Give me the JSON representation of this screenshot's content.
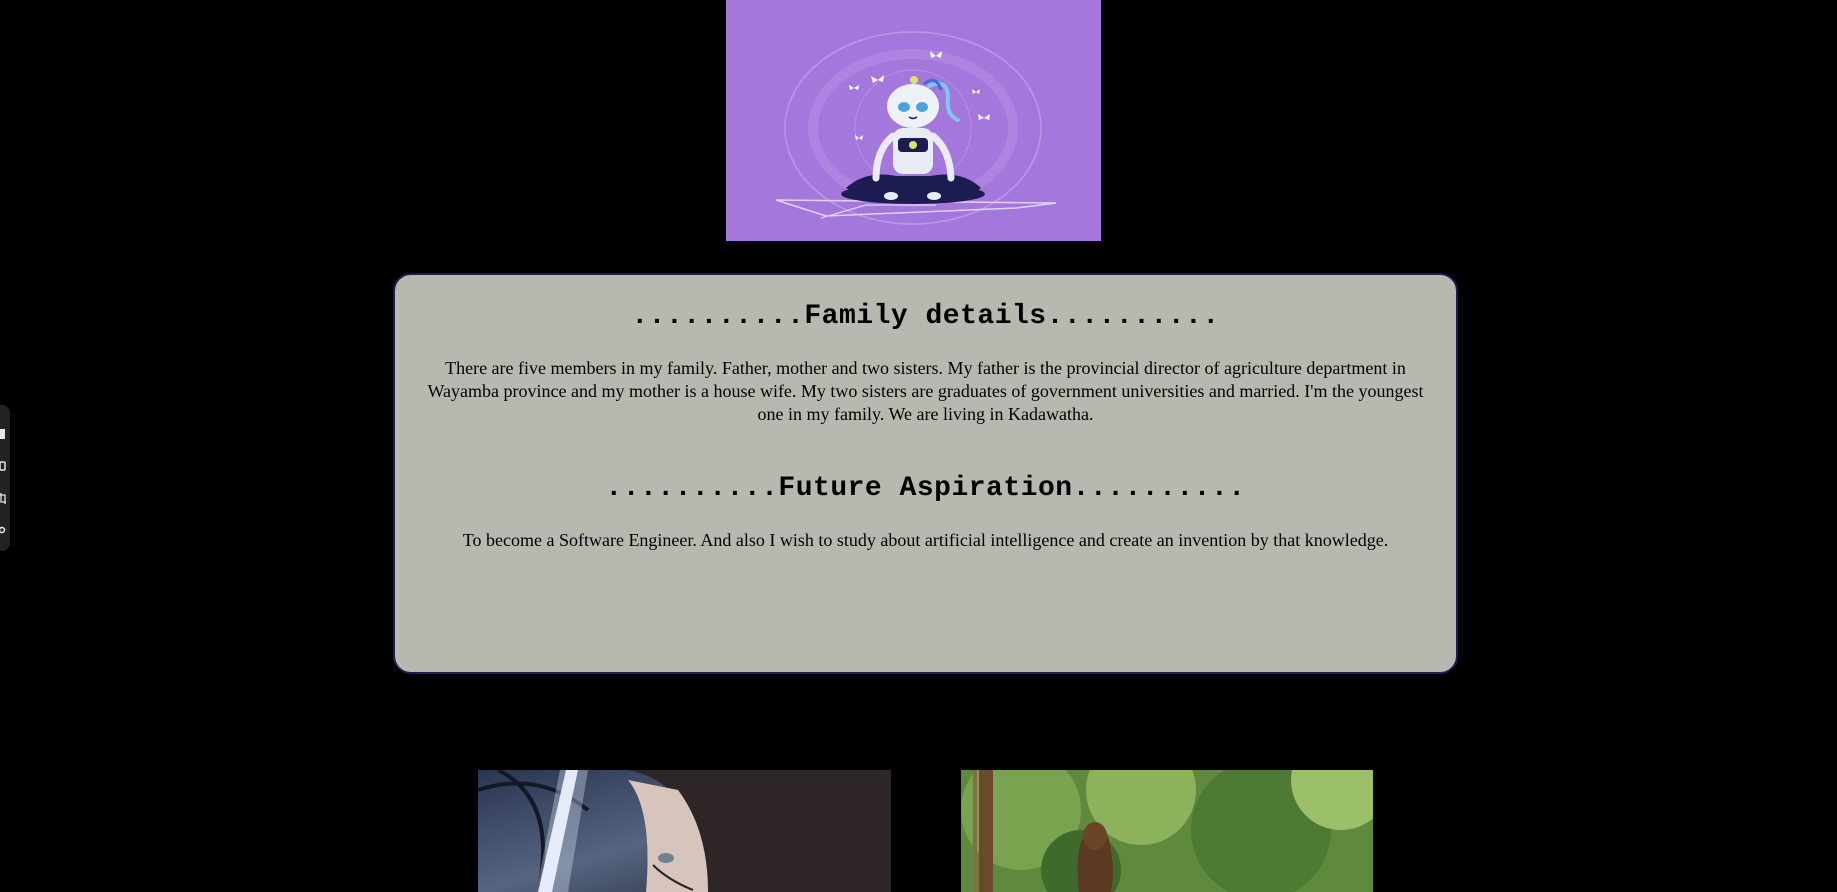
{
  "hero": {
    "icon": "meditating-robot-illustration",
    "background_color": "#a477dc"
  },
  "family": {
    "heading": "..........Family details..........",
    "text": "There are five members in my family. Father, mother and two sisters. My father is the provincial director of agriculture department in Wayamba province and my mother is a house wife. My two sisters are graduates of government universities and married. I'm the youngest one in my family. We are living in Kadawatha."
  },
  "future": {
    "heading": "..........Future Aspiration..........",
    "text": "To become a Software Engineer. And also I wish to study about artificial intelligence and create an invention by that knowledge."
  },
  "card": {
    "background_color": "#b8b8b1",
    "border_color": "#1b1d52"
  },
  "side_toolbar": {
    "tools": [
      "document-icon",
      "screen-icon",
      "crop-icon",
      "settings-icon"
    ]
  },
  "gallery": {
    "images": [
      {
        "icon": "cyborg-woman-photo"
      },
      {
        "icon": "woman-in-garden-photo"
      }
    ]
  }
}
